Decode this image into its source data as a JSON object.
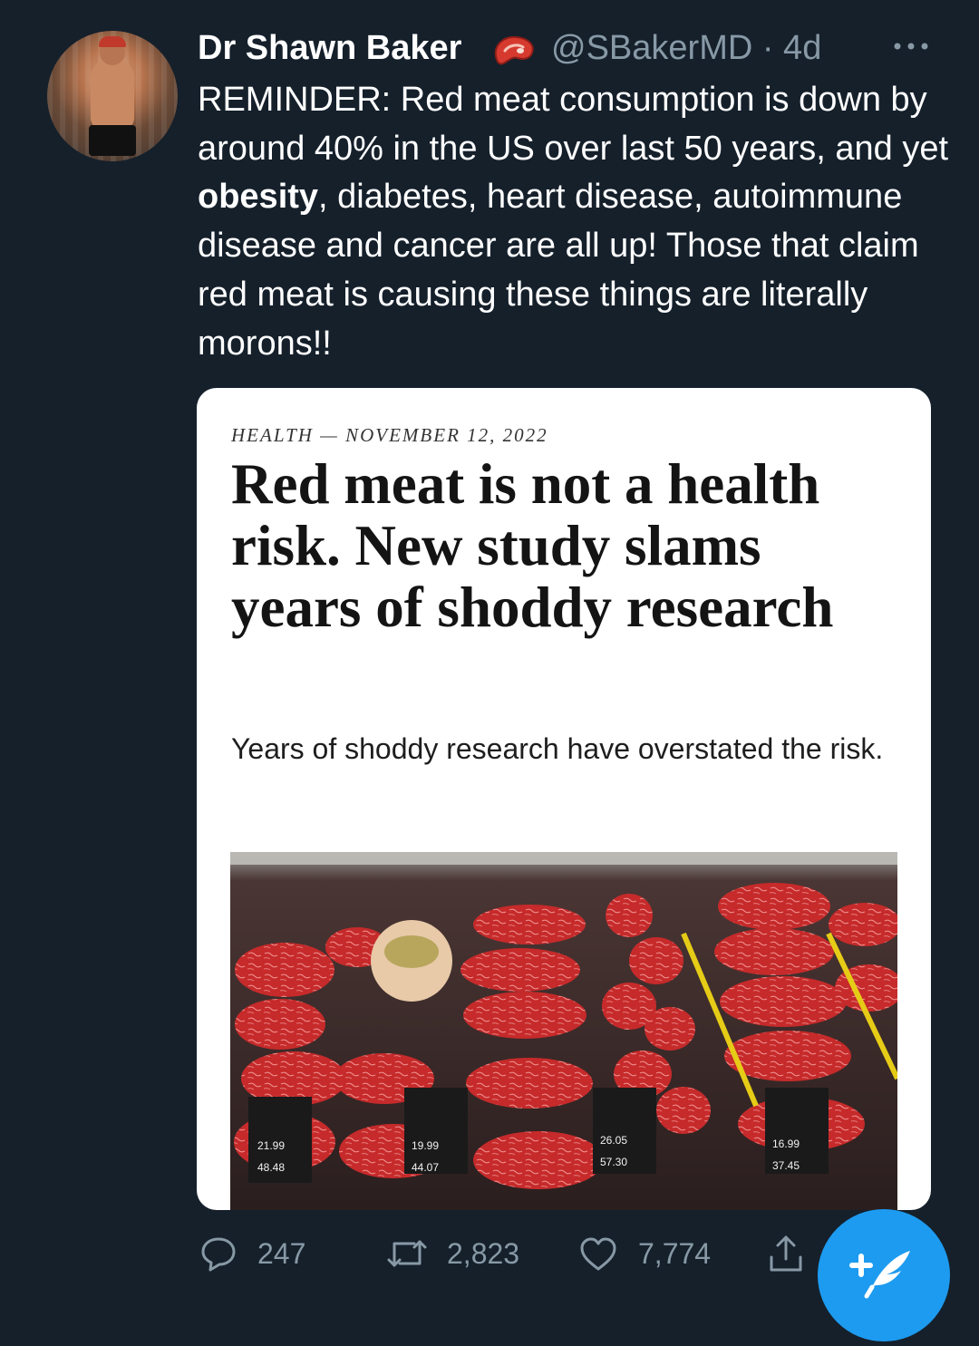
{
  "tweet": {
    "author_name": "Dr Shawn Baker",
    "author_badge_icon": "steak-icon",
    "handle_and_age": "@SBakerMD · 4d",
    "more_icon": "more-horizontal-icon",
    "text_before_bold": "REMINDER: Red meat consumption is down by around 40% in the US over last 50 years, and yet ",
    "text_bold": "obesity",
    "text_after_bold": ", diabetes, heart disease, autoimmune disease and cancer are all up! Those that claim red meat is causing these things are literally morons!!"
  },
  "card": {
    "kicker": "HEALTH — NOVEMBER 12, 2022",
    "headline": "Red meat is not a health risk. New study slams years of shoddy research",
    "subhead": "Years of shoddy research have overstated the risk.",
    "price_tags": [
      "21.99",
      "48.48",
      "19.99",
      "44.07",
      "26.05",
      "57.30",
      "16.99",
      "37.45"
    ]
  },
  "actions": {
    "replies": "247",
    "retweets": "2,823",
    "likes": "7,774",
    "icons": [
      "reply-icon",
      "retweet-icon",
      "like-icon",
      "share-icon",
      "compose-tweet-icon"
    ]
  },
  "colors": {
    "background": "#15202b",
    "secondary_text": "#8899a6",
    "accent": "#1d9bf0"
  }
}
